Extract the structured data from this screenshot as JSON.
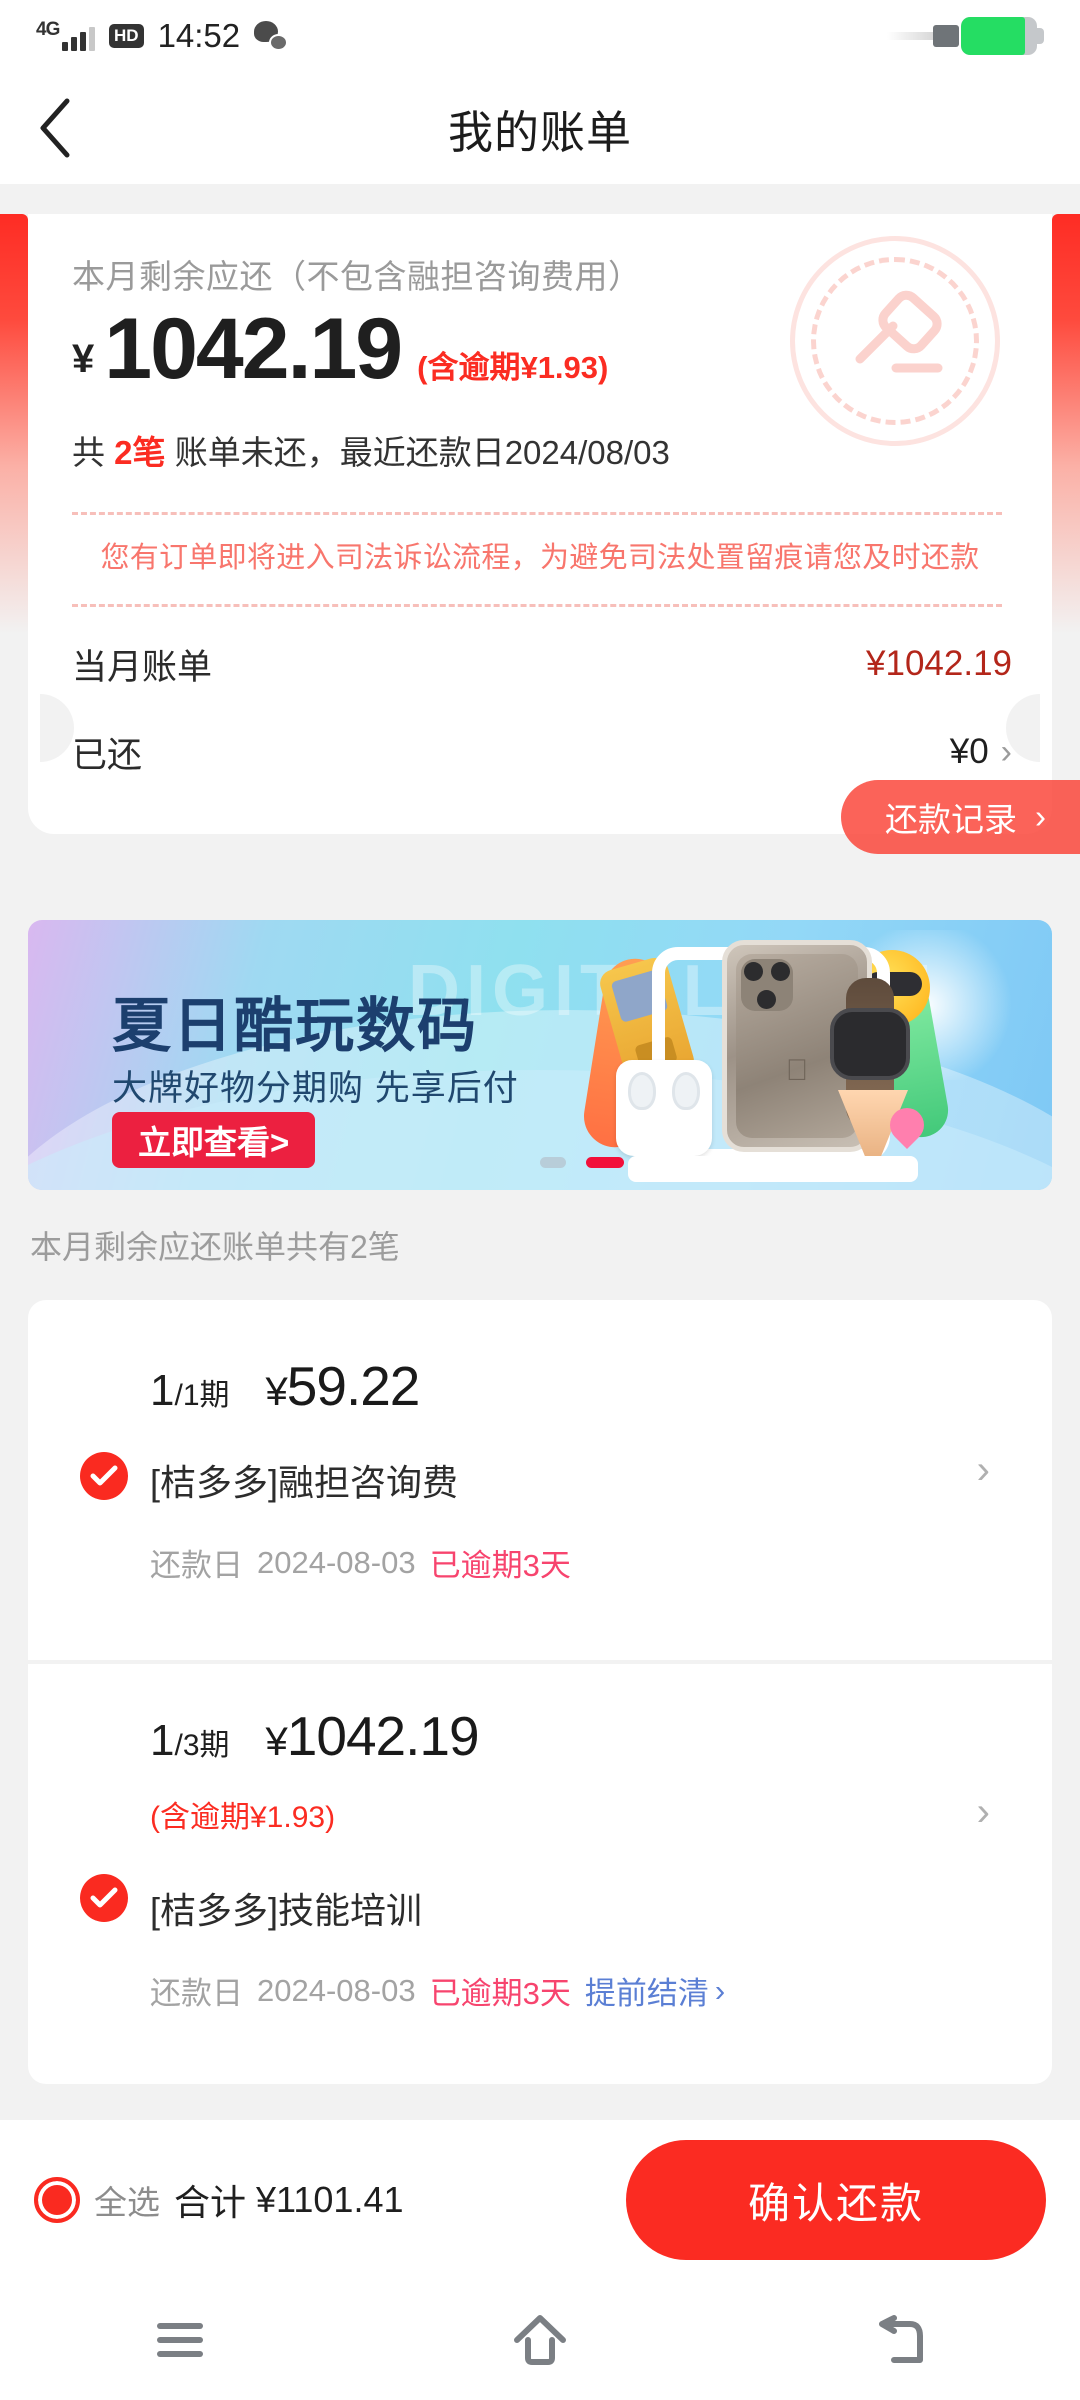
{
  "status_bar": {
    "network": "4G",
    "hd_badge": "HD",
    "time": "14:52",
    "wechat_icon": "wechat-icon",
    "battery_icon": "battery-charging-icon"
  },
  "header": {
    "back_icon": "back-chevron-icon",
    "title": "我的账单"
  },
  "summary": {
    "label": "本月剩余应还（不包含融担咨询费用）",
    "currency": "¥",
    "amount": "1042.19",
    "overdue_note": "(含逾期¥1.93)",
    "count_prefix": "共 ",
    "count_value": "2笔",
    "count_suffix": " 账单未还，最近还款日2024/08/03",
    "warning": "您有订单即将进入司法诉讼流程，为避免司法处置留痕请您及时还款",
    "watermark_icon": "gavel-icon",
    "rows": [
      {
        "label": "当月账单",
        "value": "¥1042.19",
        "chevron": "chevron-right-icon"
      },
      {
        "label": "已还",
        "value": "¥0",
        "chevron": "chevron-right-icon"
      }
    ],
    "repay_record_label": "还款记录",
    "repay_record_chevron": "chevron-right-icon",
    "collapse_icon": "chevron-up-icon"
  },
  "banner": {
    "watermark_text": "DIGITAL LIFE",
    "title": "夏日酷玩数码",
    "subtitle": "大牌好物分期购 先享后付",
    "cta": "立即查看>",
    "dots": 2,
    "active_dot": 1
  },
  "list": {
    "caption": "本月剩余应还账单共有2笔",
    "items": [
      {
        "term": "1",
        "term_total": "/1期",
        "currency": "¥",
        "amount": "59.22",
        "overdue_note": "",
        "checked": true,
        "check_icon": "check-icon",
        "name": "[桔多多]融担咨询费",
        "date_label": "还款日",
        "date": "2024-08-03",
        "overdue_status": "已逾期3天",
        "settle_link": "",
        "chevron": "chevron-right-icon"
      },
      {
        "term": "1",
        "term_total": "/3期",
        "currency": "¥",
        "amount": "1042.19",
        "overdue_note": "(含逾期¥1.93)",
        "checked": true,
        "check_icon": "check-icon",
        "name": "[桔多多]技能培训",
        "date_label": "还款日",
        "date": "2024-08-03",
        "overdue_status": "已逾期3天",
        "settle_link": "提前结清",
        "chevron": "chevron-right-icon"
      }
    ]
  },
  "bottom_bar": {
    "select_all_label": "全选",
    "select_all_checked": true,
    "total_label": "合计",
    "total_value": "¥1101.41",
    "confirm_label": "确认还款"
  },
  "nav_bar": {
    "recents_icon": "recents-icon",
    "home_icon": "home-icon",
    "back_icon": "back-icon"
  },
  "colors": {
    "brand_red": "#fb2b22",
    "warn_red": "#f8766d",
    "overdue_pink": "#f7446e",
    "link_blue": "#5b7fd4",
    "page_bg": "#f2f2f2"
  }
}
